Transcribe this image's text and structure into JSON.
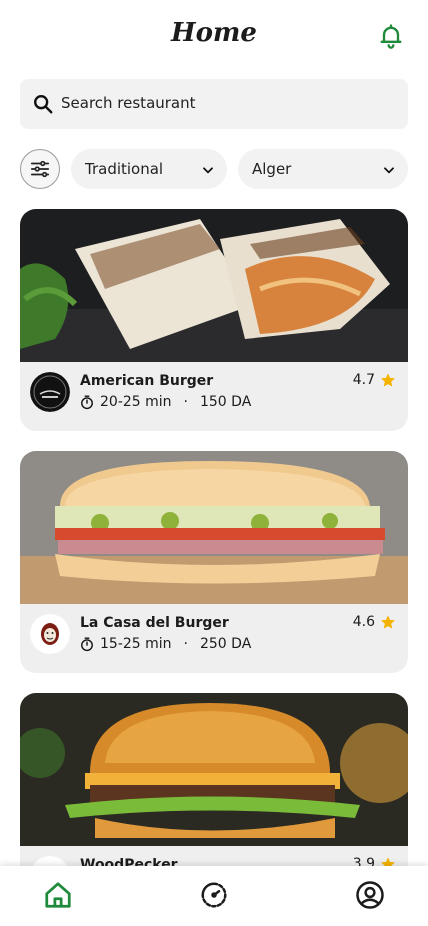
{
  "header": {
    "title": "Home",
    "bell_icon": "bell-icon"
  },
  "search": {
    "placeholder": "Search restaurant",
    "icon": "search-icon"
  },
  "filters": {
    "filter_icon": "sliders-icon",
    "category": {
      "value": "Traditional"
    },
    "city": {
      "value": "Alger"
    }
  },
  "restaurants": [
    {
      "name": "American Burger",
      "time": "20-25 min",
      "price": "150 DA",
      "rating": "4.7",
      "photo": "shawarma-wrap-photo"
    },
    {
      "name": "La Casa del Burger",
      "time": "15-25 min",
      "price": "250 DA",
      "rating": "4.6",
      "photo": "sub-sandwich-photo"
    },
    {
      "name": "WoodPecker",
      "time": "",
      "price": "",
      "rating": "3.9",
      "photo": "burger-photo"
    }
  ],
  "separator": "·",
  "tabbar": {
    "items": [
      "home-icon",
      "orders-icon",
      "profile-icon"
    ],
    "active": "home-icon"
  },
  "colors": {
    "accent_green": "#1f8a3b",
    "star": "#f5b301",
    "card_bg": "#efefef"
  }
}
